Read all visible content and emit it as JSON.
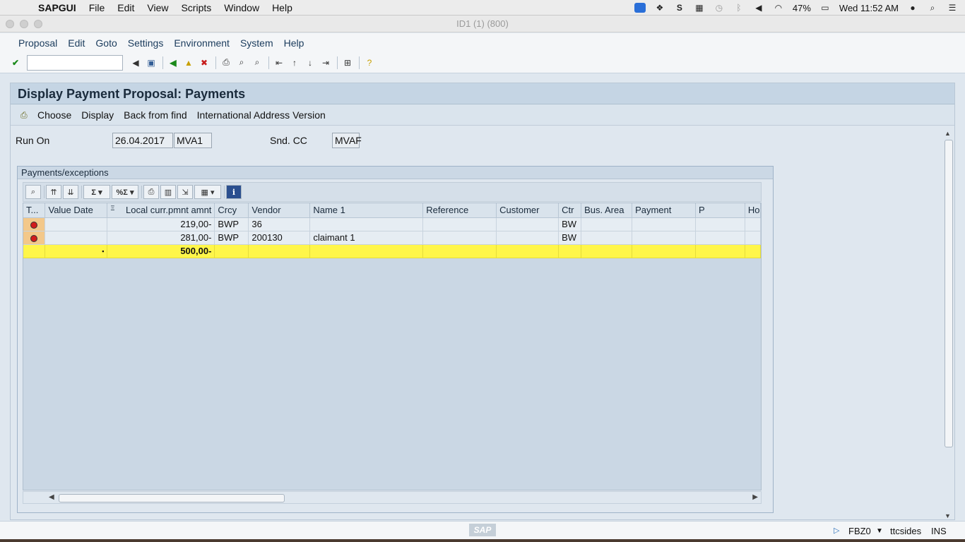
{
  "mac_menubar": {
    "app_name": "SAPGUI",
    "items": [
      "File",
      "Edit",
      "View",
      "Scripts",
      "Window",
      "Help"
    ],
    "battery": "47%",
    "clock": "Wed 11:52 AM"
  },
  "window": {
    "title": "ID1 (1) (800)"
  },
  "sap_menu": {
    "items": [
      "Proposal",
      "Edit",
      "Goto",
      "Settings",
      "Environment",
      "System",
      "Help"
    ]
  },
  "screen": {
    "title": "Display Payment Proposal: Payments",
    "toolbar": {
      "choose": "Choose",
      "display": "Display",
      "back_from_find": "Back from find",
      "intl_address": "International Address Version"
    },
    "run_on_label": "Run On",
    "run_on_date": "26.04.2017",
    "run_on_id": "MVA1",
    "snd_cc_label": "Snd. CC",
    "snd_cc_value": "MVAF"
  },
  "group": {
    "title": "Payments/exceptions"
  },
  "grid": {
    "columns": [
      "T...",
      "Value Date",
      "Local curr.pmnt amnt",
      "Crcy",
      "Vendor",
      "Name 1",
      "Reference",
      "Customer",
      "Ctr",
      "Bus. Area",
      "Payment",
      "P",
      "Ho"
    ],
    "rows": [
      {
        "value_date": "",
        "amount": "219,00-",
        "crcy": "BWP",
        "vendor": "36",
        "name1": "",
        "reference": "",
        "customer": "",
        "ctr": "BW",
        "bus_area": "",
        "payment": "",
        "p": "",
        "ho": ""
      },
      {
        "value_date": "",
        "amount": "281,00-",
        "crcy": "BWP",
        "vendor": "200130",
        "name1": "claimant 1",
        "reference": "",
        "customer": "",
        "ctr": "BW",
        "bus_area": "",
        "payment": "",
        "p": "",
        "ho": ""
      }
    ],
    "total": {
      "marker": "▪",
      "amount": "500,00-"
    }
  },
  "statusbar": {
    "transaction": "FBZ0",
    "server": "ttcsides",
    "mode": "INS",
    "logo": "SAP"
  }
}
